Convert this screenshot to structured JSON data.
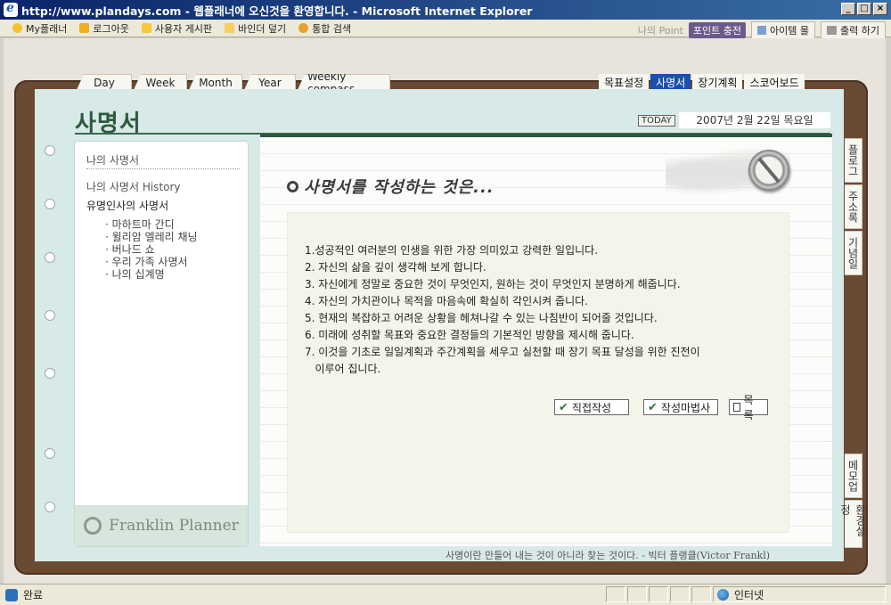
{
  "window": {
    "title": "http://www.plandays.com - 웹플래너에 오신것을 환영합니다. - Microsoft Internet Explorer",
    "btn_minimize": "_",
    "btn_maximize": "□",
    "btn_close": "×"
  },
  "toolbar": {
    "items": [
      "My플래너",
      "로그아웃",
      "사용자 게시판",
      "바인더 덮기",
      "통합 검색"
    ],
    "point_label": "나의 Point",
    "point_charge": "포인트 충전",
    "item_mall": "아이템 몰",
    "print": "출력 하기"
  },
  "tabs_left": [
    "Day",
    "Week",
    "Month",
    "Year",
    "Weekly compass"
  ],
  "tabs_right": [
    "목표설정",
    "사명서",
    "장기계획",
    "스코어보드"
  ],
  "active_tab": "사명서",
  "page": {
    "title": "사명서",
    "today_label": "TODAY",
    "date": "2007년 2월 22일 목요일"
  },
  "sidebar": {
    "my_mission": "나의 사명서",
    "history": "나의 사명서 History",
    "famous": "유명인사의 사명서",
    "sub_items": [
      "· 마하트마 간디",
      "· 윌리암 엘레리 채닝",
      "· 버나드 쇼",
      "· 우리 가족 사명서",
      "· 나의 십계명"
    ],
    "brand": "Franklin Planner"
  },
  "main": {
    "heading": "사명서를 작성하는 것은...",
    "list": [
      "1.성공적인 여러분의 인생을 위한 가장 의미있고 강력한 일입니다.",
      "2. 자신의 삶을 깊이 생각해 보게 합니다.",
      "3. 자신에게 정말로 중요한 것이 무엇인지, 원하는 것이 무엇인지 분명하게 해줍니다.",
      "4. 자신의 가치관이나 목적을 마음속에 확실히 각인시켜 줍니다.",
      "5. 현재의 복잡하고 어려운 상황을 헤쳐나갈 수 있는 나침반이 되어줄 것입니다.",
      "6. 미래에 성취할 목표와 중요한 결정들의 기본적인 방향을 제시해 줍니다.",
      "7. 이것을 기초로 일일계획과 주간계획을 세우고 실천할 때 장기 목표 달성을 위한 진전이",
      "   이루어 집니다."
    ],
    "btn_direct": "직접작성",
    "btn_wizard": "작성마법사",
    "btn_list": "목록",
    "quote": "사명이란 만들어 내는 것이 아니라 찾는 것이다. - 빅터 플랭클(Victor Frankl)"
  },
  "right_tabs": [
    "플로그",
    "주소록",
    "기념일",
    "메모업",
    "환경설정"
  ],
  "status": {
    "text": "완료",
    "zone": "인터넷"
  },
  "colors": {
    "title_bar": "#0a246a",
    "active_tab": "#1b4fb0",
    "binder": "#6b4a33",
    "page_title": "#2f5a3e"
  }
}
